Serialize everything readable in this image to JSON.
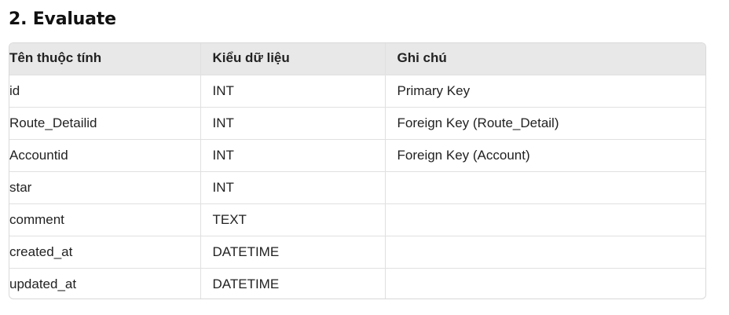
{
  "section": {
    "title": "2. Evaluate"
  },
  "table": {
    "headers": [
      "Tên thuộc tính",
      "Kiểu dữ liệu",
      "Ghi chú"
    ],
    "rows": [
      [
        "id",
        "INT",
        "Primary Key"
      ],
      [
        "Route_Detailid",
        "INT",
        "Foreign Key (Route_Detail)"
      ],
      [
        "Accountid",
        "INT",
        "Foreign Key (Account)"
      ],
      [
        "star",
        "INT",
        ""
      ],
      [
        "comment",
        "TEXT",
        ""
      ],
      [
        "created_at",
        "DATETIME",
        ""
      ],
      [
        "updated_at",
        "DATETIME",
        ""
      ]
    ]
  }
}
